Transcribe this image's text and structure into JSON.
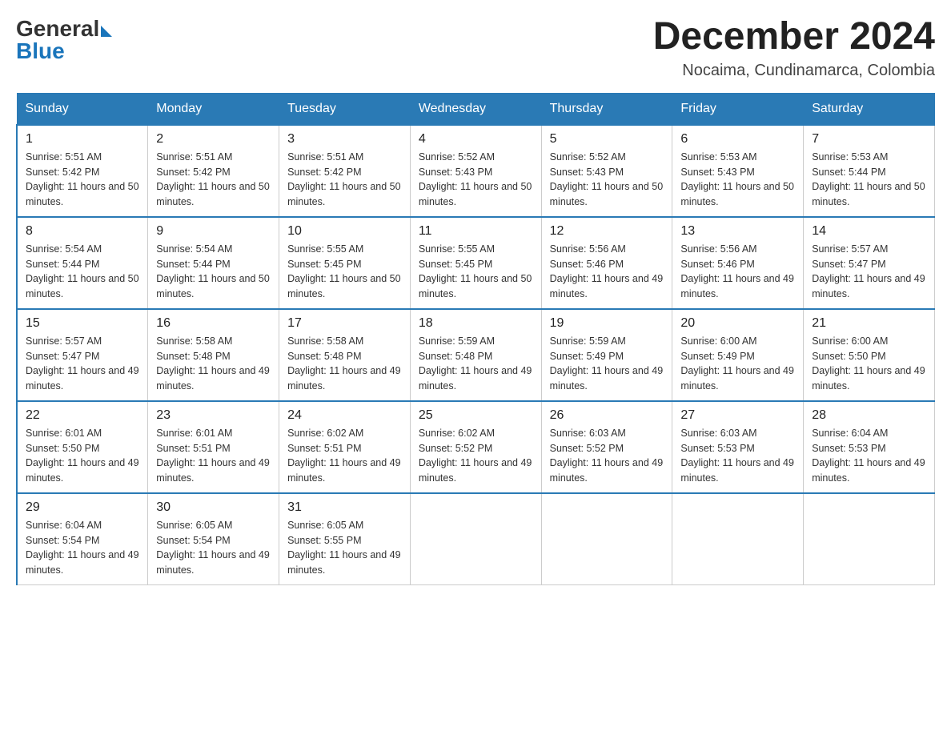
{
  "header": {
    "logo": {
      "general": "General",
      "blue": "Blue"
    },
    "title": "December 2024",
    "location": "Nocaima, Cundinamarca, Colombia"
  },
  "days_of_week": [
    "Sunday",
    "Monday",
    "Tuesday",
    "Wednesday",
    "Thursday",
    "Friday",
    "Saturday"
  ],
  "weeks": [
    [
      {
        "day": "1",
        "sunrise": "5:51 AM",
        "sunset": "5:42 PM",
        "daylight": "11 hours and 50 minutes."
      },
      {
        "day": "2",
        "sunrise": "5:51 AM",
        "sunset": "5:42 PM",
        "daylight": "11 hours and 50 minutes."
      },
      {
        "day": "3",
        "sunrise": "5:51 AM",
        "sunset": "5:42 PM",
        "daylight": "11 hours and 50 minutes."
      },
      {
        "day": "4",
        "sunrise": "5:52 AM",
        "sunset": "5:43 PM",
        "daylight": "11 hours and 50 minutes."
      },
      {
        "day": "5",
        "sunrise": "5:52 AM",
        "sunset": "5:43 PM",
        "daylight": "11 hours and 50 minutes."
      },
      {
        "day": "6",
        "sunrise": "5:53 AM",
        "sunset": "5:43 PM",
        "daylight": "11 hours and 50 minutes."
      },
      {
        "day": "7",
        "sunrise": "5:53 AM",
        "sunset": "5:44 PM",
        "daylight": "11 hours and 50 minutes."
      }
    ],
    [
      {
        "day": "8",
        "sunrise": "5:54 AM",
        "sunset": "5:44 PM",
        "daylight": "11 hours and 50 minutes."
      },
      {
        "day": "9",
        "sunrise": "5:54 AM",
        "sunset": "5:44 PM",
        "daylight": "11 hours and 50 minutes."
      },
      {
        "day": "10",
        "sunrise": "5:55 AM",
        "sunset": "5:45 PM",
        "daylight": "11 hours and 50 minutes."
      },
      {
        "day": "11",
        "sunrise": "5:55 AM",
        "sunset": "5:45 PM",
        "daylight": "11 hours and 50 minutes."
      },
      {
        "day": "12",
        "sunrise": "5:56 AM",
        "sunset": "5:46 PM",
        "daylight": "11 hours and 49 minutes."
      },
      {
        "day": "13",
        "sunrise": "5:56 AM",
        "sunset": "5:46 PM",
        "daylight": "11 hours and 49 minutes."
      },
      {
        "day": "14",
        "sunrise": "5:57 AM",
        "sunset": "5:47 PM",
        "daylight": "11 hours and 49 minutes."
      }
    ],
    [
      {
        "day": "15",
        "sunrise": "5:57 AM",
        "sunset": "5:47 PM",
        "daylight": "11 hours and 49 minutes."
      },
      {
        "day": "16",
        "sunrise": "5:58 AM",
        "sunset": "5:48 PM",
        "daylight": "11 hours and 49 minutes."
      },
      {
        "day": "17",
        "sunrise": "5:58 AM",
        "sunset": "5:48 PM",
        "daylight": "11 hours and 49 minutes."
      },
      {
        "day": "18",
        "sunrise": "5:59 AM",
        "sunset": "5:48 PM",
        "daylight": "11 hours and 49 minutes."
      },
      {
        "day": "19",
        "sunrise": "5:59 AM",
        "sunset": "5:49 PM",
        "daylight": "11 hours and 49 minutes."
      },
      {
        "day": "20",
        "sunrise": "6:00 AM",
        "sunset": "5:49 PM",
        "daylight": "11 hours and 49 minutes."
      },
      {
        "day": "21",
        "sunrise": "6:00 AM",
        "sunset": "5:50 PM",
        "daylight": "11 hours and 49 minutes."
      }
    ],
    [
      {
        "day": "22",
        "sunrise": "6:01 AM",
        "sunset": "5:50 PM",
        "daylight": "11 hours and 49 minutes."
      },
      {
        "day": "23",
        "sunrise": "6:01 AM",
        "sunset": "5:51 PM",
        "daylight": "11 hours and 49 minutes."
      },
      {
        "day": "24",
        "sunrise": "6:02 AM",
        "sunset": "5:51 PM",
        "daylight": "11 hours and 49 minutes."
      },
      {
        "day": "25",
        "sunrise": "6:02 AM",
        "sunset": "5:52 PM",
        "daylight": "11 hours and 49 minutes."
      },
      {
        "day": "26",
        "sunrise": "6:03 AM",
        "sunset": "5:52 PM",
        "daylight": "11 hours and 49 minutes."
      },
      {
        "day": "27",
        "sunrise": "6:03 AM",
        "sunset": "5:53 PM",
        "daylight": "11 hours and 49 minutes."
      },
      {
        "day": "28",
        "sunrise": "6:04 AM",
        "sunset": "5:53 PM",
        "daylight": "11 hours and 49 minutes."
      }
    ],
    [
      {
        "day": "29",
        "sunrise": "6:04 AM",
        "sunset": "5:54 PM",
        "daylight": "11 hours and 49 minutes."
      },
      {
        "day": "30",
        "sunrise": "6:05 AM",
        "sunset": "5:54 PM",
        "daylight": "11 hours and 49 minutes."
      },
      {
        "day": "31",
        "sunrise": "6:05 AM",
        "sunset": "5:55 PM",
        "daylight": "11 hours and 49 minutes."
      },
      null,
      null,
      null,
      null
    ]
  ]
}
